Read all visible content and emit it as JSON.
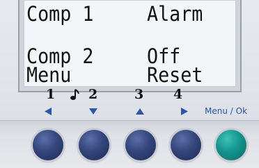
{
  "display": {
    "line1_left": "Comp 1",
    "line1_right": "Alarm",
    "line3_left": "Comp 2",
    "line3_right": "Off",
    "line4_left": "Menu",
    "line4_right": "Reset"
  },
  "key_numbers": [
    "1",
    "2",
    "3",
    "4"
  ],
  "softkeys": {
    "icons": [
      "left-arrow-icon",
      "down-arrow-icon",
      "up-arrow-icon",
      "right-arrow-icon"
    ],
    "menu_ok_label": "Menu / Ok"
  },
  "colors": {
    "arrow_blue": "#2a55a8",
    "button_blue": "#34467b",
    "button_teal": "#14948c"
  }
}
